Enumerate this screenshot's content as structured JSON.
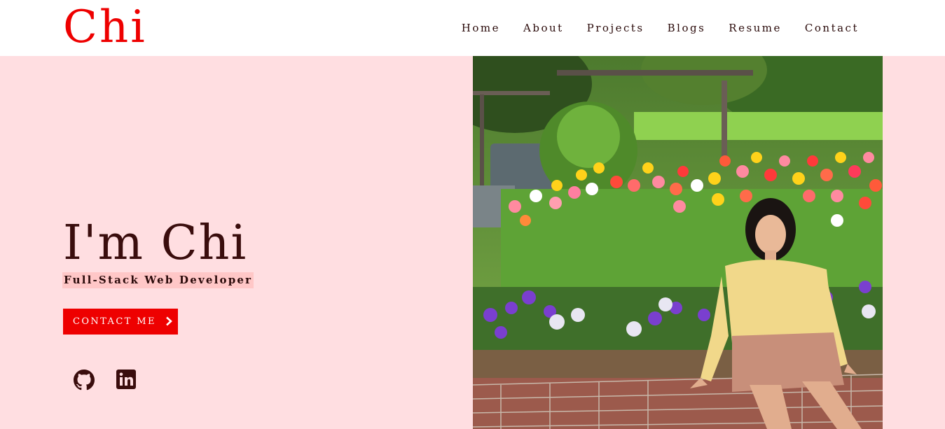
{
  "header": {
    "logo": "Chi",
    "nav": [
      {
        "label": "Home"
      },
      {
        "label": "About"
      },
      {
        "label": "Projects"
      },
      {
        "label": "Blogs"
      },
      {
        "label": "Resume"
      },
      {
        "label": "Contact"
      }
    ]
  },
  "hero": {
    "title": "I'm Chi",
    "subtitle": "Full-Stack Web Developer",
    "cta_label": "CONTACT ME",
    "cta_icon": "chevron-right-icon"
  },
  "social": [
    {
      "icon": "github-icon"
    },
    {
      "icon": "linkedin-icon"
    }
  ],
  "photo": {
    "subject": "portrait-in-tulip-garden"
  },
  "colors": {
    "background": "#ffdee1",
    "accent": "#ee0000",
    "text": "#3a0d0d",
    "subtitle_highlight": "#ffc7c7"
  }
}
